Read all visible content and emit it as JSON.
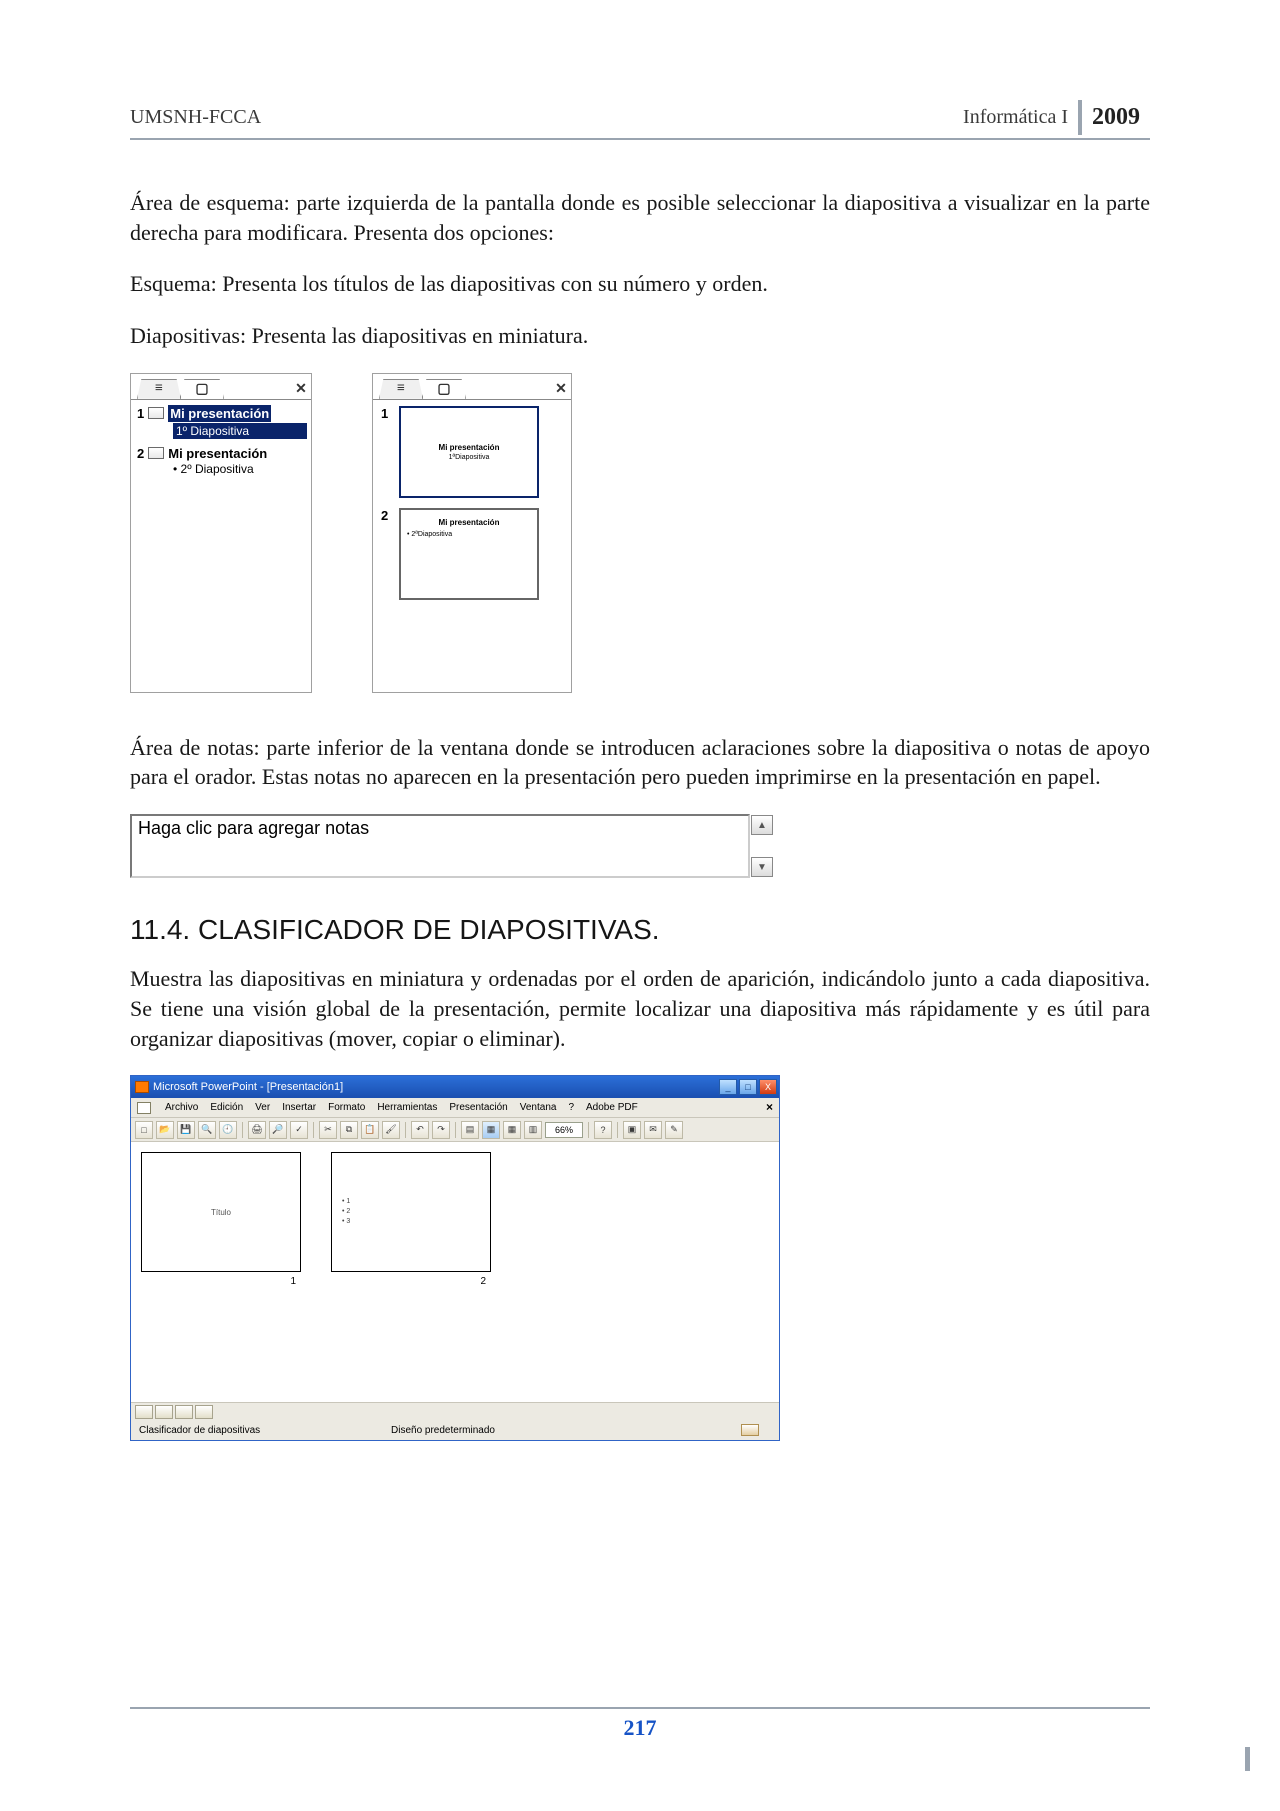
{
  "header": {
    "left": "UMSNH-FCCA",
    "subject": "Informática I",
    "year": "2009"
  },
  "paras": {
    "p1": "Área de esquema: parte izquierda de la pantalla donde es posible seleccionar la diapositiva a visualizar en la parte derecha para modificara. Presenta dos opciones:",
    "p2": "Esquema: Presenta los títulos de las diapositivas con su número y orden.",
    "p3": "Diapositivas: Presenta las diapositivas en miniatura.",
    "p4": "Área de notas: parte inferior de la ventana donde se introducen aclaraciones sobre la diapositiva o notas de apoyo para el orador. Estas notas no aparecen en la presentación pero pueden imprimirse en la presentación en papel.",
    "p5": "Muestra las diapositivas en miniatura y ordenadas por el orden de aparición, indicándolo junto a cada diapositiva. Se  tiene una visión global de la presentación, permite localizar una diapositiva más rápidamente y es útil para organizar diapositivas (mover, copiar o eliminar)."
  },
  "section_heading": "11.4. CLASIFICADOR DE DIAPOSITIVAS.",
  "outline_pane": {
    "tab1_glyph": "≡",
    "tab2_glyph": "▢",
    "close_glyph": "✕",
    "items": [
      {
        "num": "1",
        "title": "Mi presentación",
        "sub": "1º Diapositiva",
        "selected": true
      },
      {
        "num": "2",
        "title": "Mi presentación",
        "sub": "2º Diapositiva",
        "selected": false
      }
    ]
  },
  "thumb_pane": {
    "slides": [
      {
        "num": "1",
        "title": "Mi presentación",
        "sub": "1ªDiapositiva",
        "active": true
      },
      {
        "num": "2",
        "title": "Mi presentación",
        "sub": "2ªDiapositiva",
        "active": false
      }
    ]
  },
  "notes": {
    "placeholder": "Haga clic para agregar notas",
    "up_glyph": "▲",
    "down_glyph": "▼"
  },
  "pp": {
    "title": "Microsoft PowerPoint - [Presentación1]",
    "win_min": "_",
    "win_max": "□",
    "win_close": "X",
    "menu": [
      "Archivo",
      "Edición",
      "Ver",
      "Insertar",
      "Formato",
      "Herramientas",
      "Presentación",
      "Ventana",
      "?",
      "Adobe PDF"
    ],
    "menu_close": "×",
    "zoom": "66%",
    "slide1_label": "Título",
    "slide1_num": "1",
    "slide2_lines": [
      "• 1",
      "• 2",
      "• 3"
    ],
    "slide2_num": "2",
    "status_left": "Clasificador de diapositivas",
    "status_center": "Diseño predeterminado"
  },
  "footer": {
    "page": "217"
  }
}
